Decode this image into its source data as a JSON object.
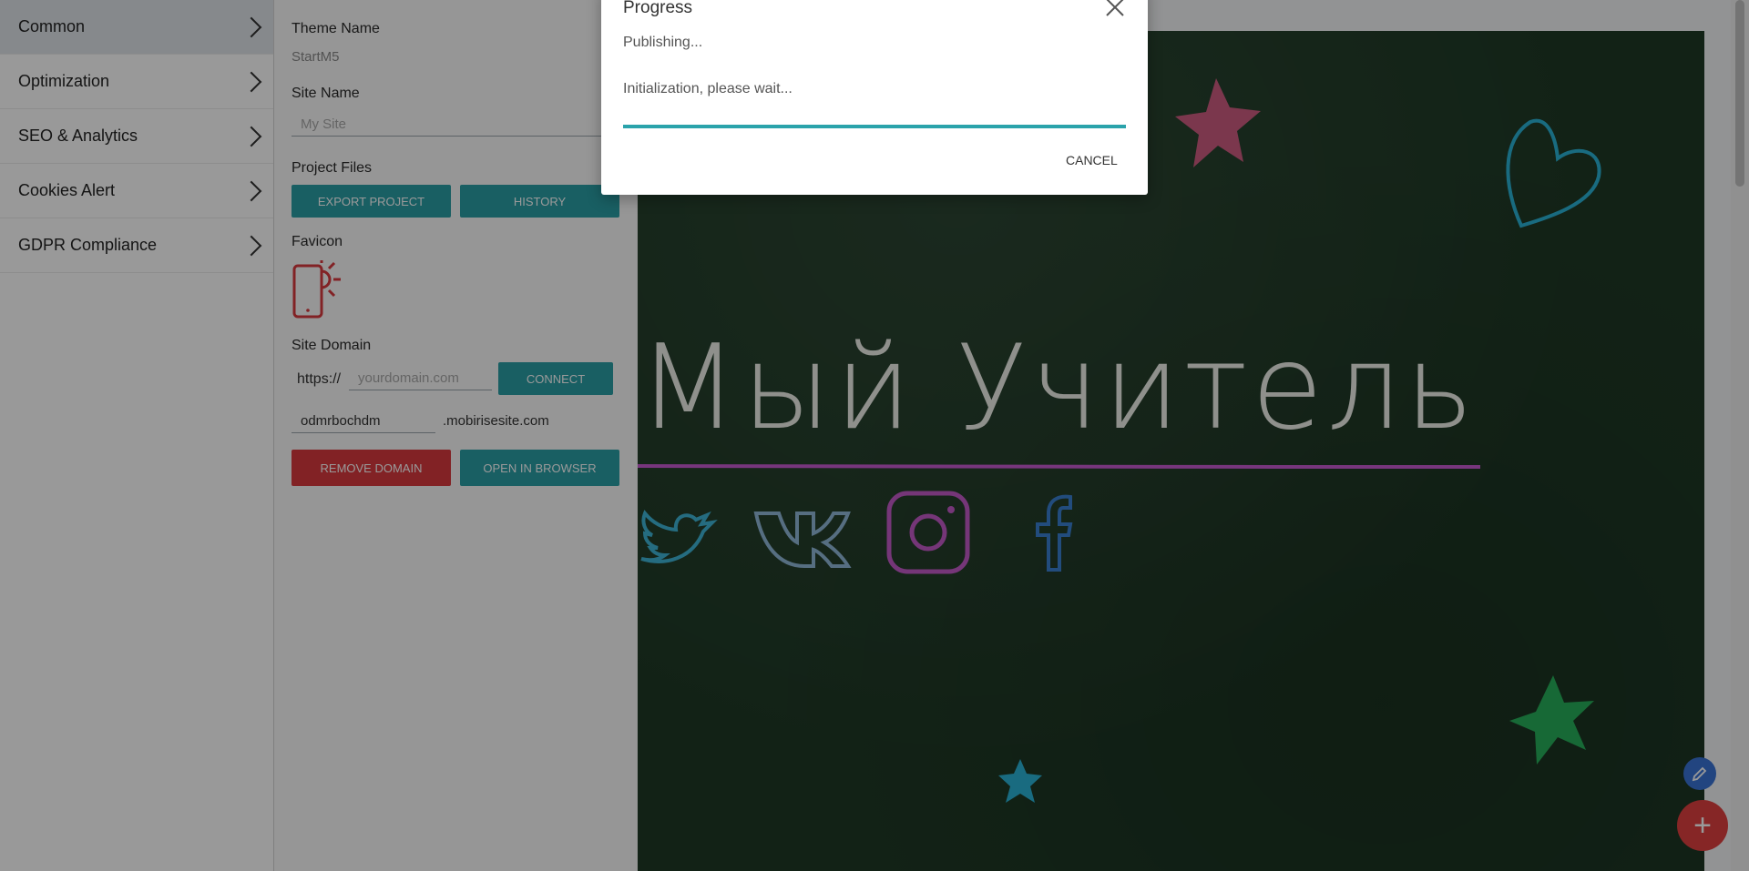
{
  "sidebar": {
    "items": [
      {
        "label": "Common",
        "active": true
      },
      {
        "label": "Optimization"
      },
      {
        "label": "SEO & Analytics"
      },
      {
        "label": "Cookies Alert"
      },
      {
        "label": "GDPR Compliance"
      }
    ]
  },
  "settings": {
    "theme_name_label": "Theme Name",
    "theme_name_value": "StartM5",
    "site_name_label": "Site Name",
    "site_name_placeholder": "My Site",
    "project_files_label": "Project Files",
    "export_button": "EXPORT PROJECT",
    "history_button": "HISTORY",
    "favicon_label": "Favicon",
    "site_domain_label": "Site Domain",
    "protocol": "https://",
    "domain_placeholder": "yourdomain.com",
    "connect_button": "CONNECT",
    "subdomain_value": "odmrbochdm",
    "subdomain_suffix": ".mobirisesite.com",
    "remove_domain_button": "REMOVE DOMAIN",
    "open_browser_button": "OPEN IN BROWSER"
  },
  "preview": {
    "title_text": "Мый Учитель",
    "social_icons": [
      "twitter-icon",
      "vk-icon",
      "instagram-icon",
      "facebook-icon"
    ]
  },
  "dialog": {
    "title": "Progress",
    "status": "Publishing...",
    "message": "Initialization, please wait...",
    "progress": 1.0,
    "cancel_label": "CANCEL"
  },
  "colors": {
    "accent": "#2b9ea6",
    "danger": "#d9393e",
    "chalkboard": "#1f3a26",
    "fab_add": "#e04040",
    "fab_edit": "#3a74d6"
  }
}
